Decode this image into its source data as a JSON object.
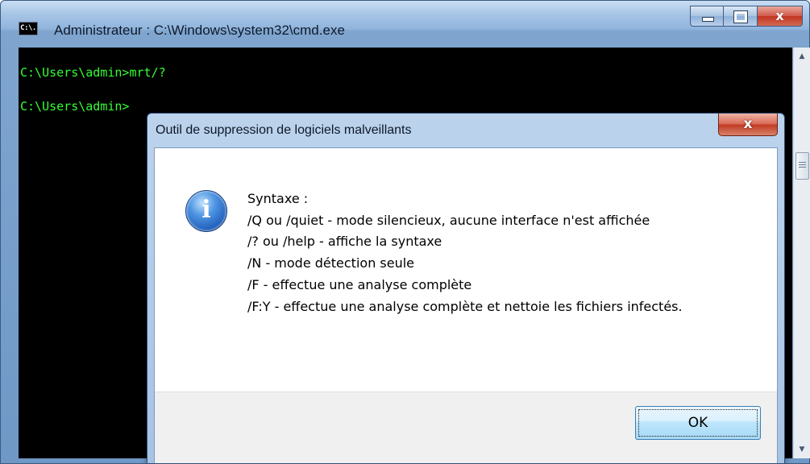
{
  "cmd": {
    "icon_text": "C:\\.",
    "title": "Administrateur : C:\\Windows\\system32\\cmd.exe",
    "lines": [
      "C:\\Users\\admin>mrt/?",
      "C:\\Users\\admin>"
    ],
    "console_color": "#33ff33"
  },
  "window_controls": {
    "close_glyph": "x"
  },
  "dialog": {
    "title": "Outil de suppression de logiciels malveillants",
    "close_glyph": "x",
    "icon_glyph": "i",
    "message_lines": [
      "Syntaxe :",
      "/Q ou /quiet - mode silencieux, aucune interface n'est affichée",
      "/? ou /help - affiche la syntaxe",
      "/N - mode détection seule",
      "/F - effectue une analyse complète",
      "/F:Y - effectue une analyse complète et nettoie les fichiers infectés."
    ],
    "ok_label": "OK"
  }
}
